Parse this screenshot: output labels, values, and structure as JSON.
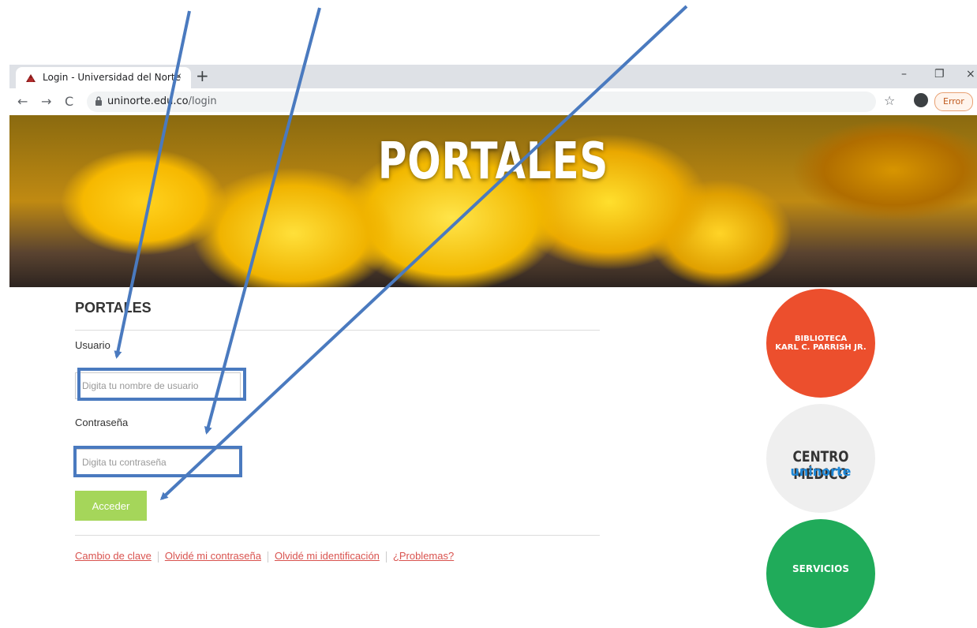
{
  "browser": {
    "tab_title": "Login - Universidad del Norte",
    "tab_close": "×",
    "new_tab": "+",
    "url_host": "uninorte.edu.co",
    "url_path": "/login",
    "error_label": "Error",
    "window_minimize": "–",
    "window_restore": "❐",
    "window_close": "×",
    "back": "←",
    "forward": "→",
    "reload": "C",
    "star": "☆"
  },
  "hero": {
    "title": "PORTALES"
  },
  "main": {
    "section_title": "PORTALES",
    "username_label": "Usuario",
    "username_placeholder": "Digita tu nombre de usuario",
    "password_label": "Contraseña",
    "password_placeholder": "Digita tu contraseña",
    "submit_label": "Acceder",
    "links": [
      "Cambio de clave",
      "Olvidé mi contraseña",
      "Olvidé mi identificación",
      "¿Problemas?"
    ]
  },
  "sidebar": {
    "biblioteca": "BIBLIOTECA\nKARL C. PARRISH JR.",
    "centro_medico_title": "CENTRO MÉDICO",
    "centro_medico_sub": "uninorte",
    "servicios": "SERVICIOS"
  },
  "colors": {
    "annotation": "#4a7abf",
    "submit": "#a5d65a",
    "biblioteca": "#ec4f2d",
    "servicios": "#20ab5a",
    "link": "#d9534f"
  },
  "icons": [
    "favicon-icon",
    "lock-icon",
    "profile-icon",
    "star-icon"
  ]
}
